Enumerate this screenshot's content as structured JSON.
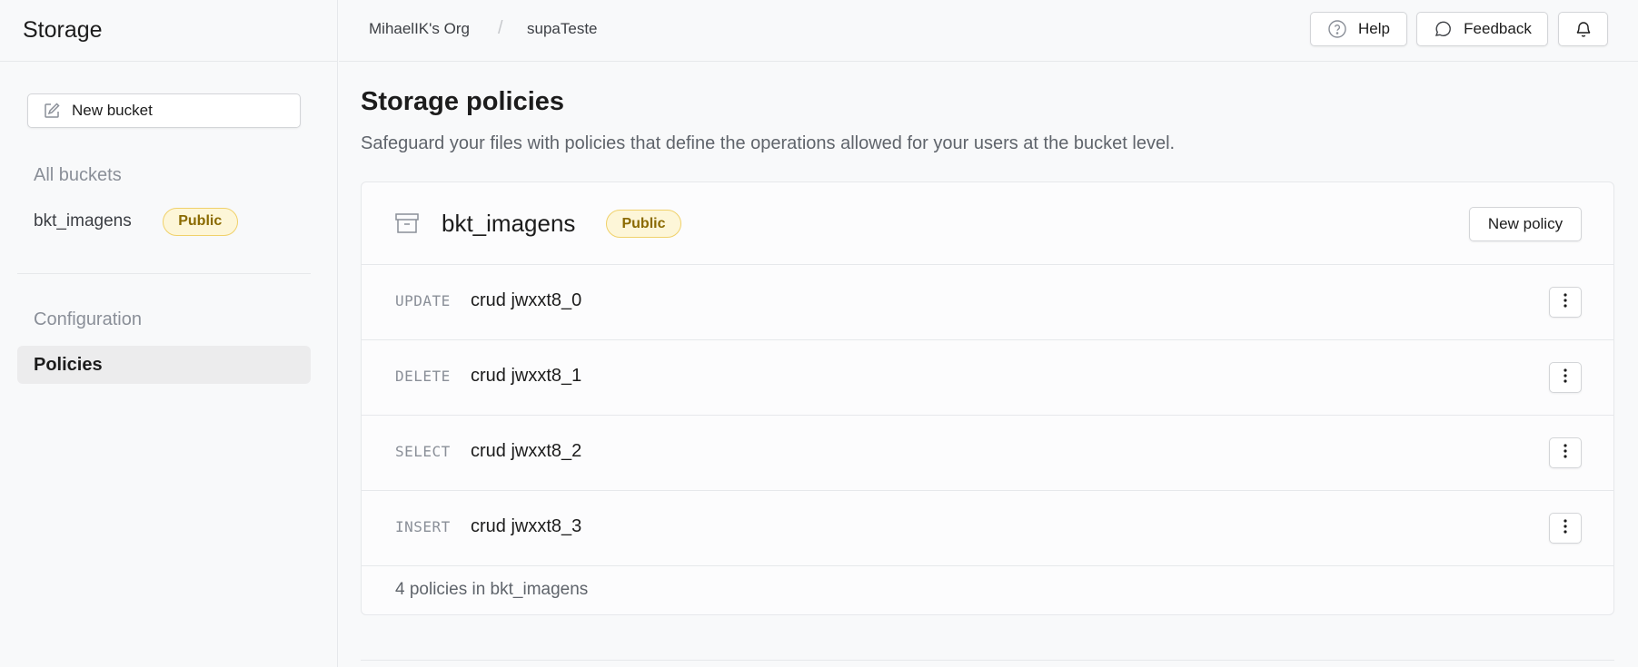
{
  "sidebar": {
    "title": "Storage",
    "new_bucket_label": "New bucket",
    "all_buckets_label": "All buckets",
    "buckets": [
      {
        "name": "bkt_imagens",
        "badge": "Public"
      }
    ],
    "configuration_label": "Configuration",
    "policies_label": "Policies"
  },
  "topbar": {
    "breadcrumb": [
      "MihaelIK's Org",
      "supaTeste"
    ],
    "breadcrumb_separator": "/",
    "help_label": "Help",
    "feedback_label": "Feedback"
  },
  "main": {
    "title": "Storage policies",
    "description": "Safeguard your files with policies that define the operations allowed for your users at the bucket level.",
    "bucket": {
      "name": "bkt_imagens",
      "badge": "Public",
      "new_policy_label": "New policy",
      "policies": [
        {
          "operation": "UPDATE",
          "name": "crud jwxxt8_0"
        },
        {
          "operation": "DELETE",
          "name": "crud jwxxt8_1"
        },
        {
          "operation": "SELECT",
          "name": "crud jwxxt8_2"
        },
        {
          "operation": "INSERT",
          "name": "crud jwxxt8_3"
        }
      ],
      "footer": "4 policies in bkt_imagens"
    }
  },
  "colors": {
    "badge_border": "#f0d16a",
    "badge_bg": "#fdf6d8",
    "badge_text": "#8a6a00",
    "active_nav_bg": "#ececed"
  },
  "icons": {
    "new_bucket": "edit-icon",
    "help": "question-circle-icon",
    "feedback": "message-circle-icon",
    "notifications": "bell-icon",
    "bucket": "archive-icon",
    "row_menu": "more-vertical-icon"
  }
}
